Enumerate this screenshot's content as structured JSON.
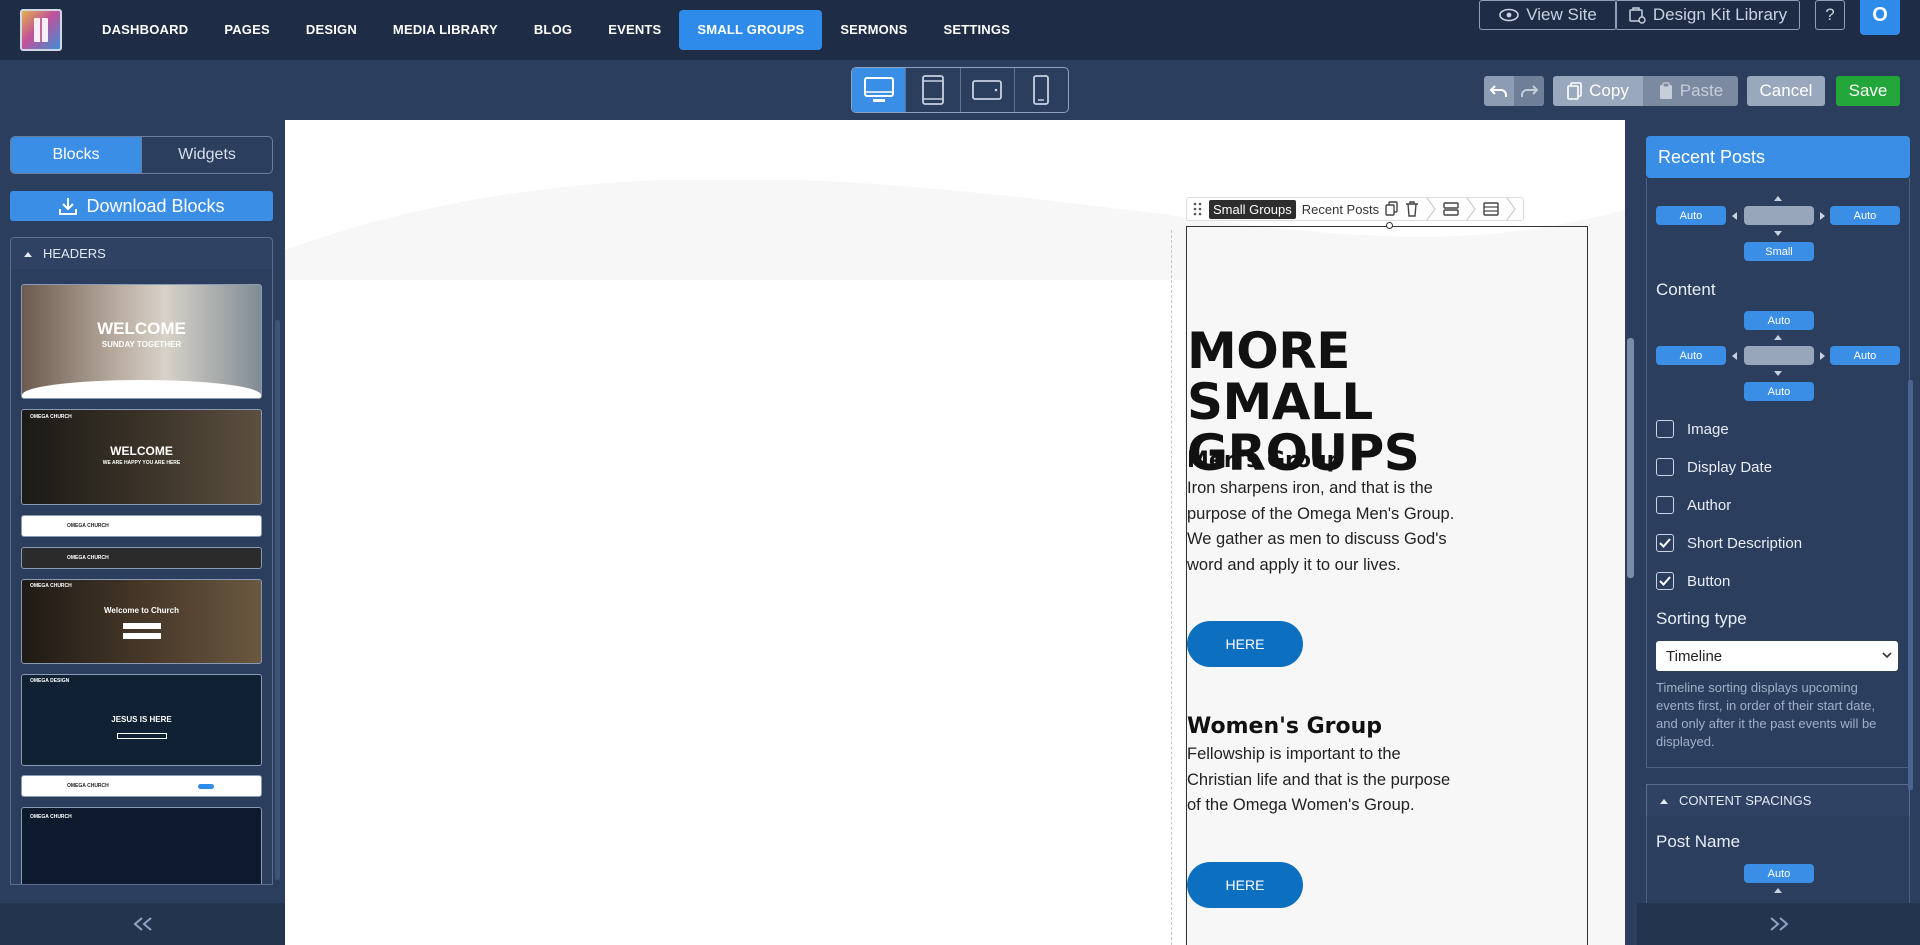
{
  "nav": {
    "items": [
      "DASHBOARD",
      "PAGES",
      "DESIGN",
      "MEDIA LIBRARY",
      "BLOG",
      "EVENTS",
      "SMALL GROUPS",
      "SERMONS",
      "SETTINGS"
    ],
    "active": "SMALL GROUPS",
    "view_site": "View Site",
    "design_kit": "Design Kit Library",
    "help": "?",
    "avatar": "O"
  },
  "toolbar": {
    "copy": "Copy",
    "paste": "Paste",
    "cancel": "Cancel",
    "save": "Save",
    "save_color": "#22a63a"
  },
  "left": {
    "tabs": [
      "Blocks",
      "Widgets"
    ],
    "download": "Download Blocks",
    "section": "HEADERS",
    "thumbs": {
      "t1_title": "WELCOME",
      "t1_sub": "SUNDAY TOGETHER",
      "t2_brand": "OMEGA CHURCH",
      "t2_title": "WELCOME",
      "t2_sub": "WE ARE HAPPY YOU ARE HERE",
      "t3_brand": "OMEGA CHURCH",
      "t4_brand": "OMEGA CHURCH",
      "t5_brand": "OMEGA CHURCH",
      "t5_title": "Welcome to Church",
      "t6_brand": "OMEGA DESIGN",
      "t6_title": "JESUS IS HERE",
      "t7_brand": "OMEGA CHURCH",
      "t8_brand": "OMEGA CHURCH"
    }
  },
  "canvas": {
    "breadcrumb": {
      "tag": "Small Groups",
      "name": "Recent Posts"
    },
    "heading": "MORE SMALL GROUPS",
    "posts": [
      {
        "title": "Men's Group",
        "body": "Iron sharpens iron, and that is the purpose of the Omega Men's Group. We gather as men to discuss God's word and apply it to our lives.",
        "button": "HERE"
      },
      {
        "title": "Women's Group",
        "body": "Fellowship is important to the Christian life and that is the purpose of the Omega Women's Group.",
        "button": "HERE"
      }
    ]
  },
  "right": {
    "title": "Recent Posts",
    "spacing_top": {
      "left": "Auto",
      "right": "Auto",
      "bottom": "Small"
    },
    "content_label": "Content",
    "content_spacing": {
      "top": "Auto",
      "left": "Auto",
      "right": "Auto",
      "bottom": "Auto"
    },
    "checks": [
      {
        "label": "Image",
        "checked": false
      },
      {
        "label": "Display Date",
        "checked": false
      },
      {
        "label": "Author",
        "checked": false
      },
      {
        "label": "Short Description",
        "checked": true
      },
      {
        "label": "Button",
        "checked": true
      }
    ],
    "sorting_label": "Sorting type",
    "sorting_value": "Timeline",
    "sorting_help": "Timeline sorting displays upcoming events first, in order of their start date, and only after it the past events will be displayed.",
    "spacings_section": "CONTENT SPACINGS",
    "post_name_label": "Post Name",
    "post_name_top": "Auto"
  }
}
